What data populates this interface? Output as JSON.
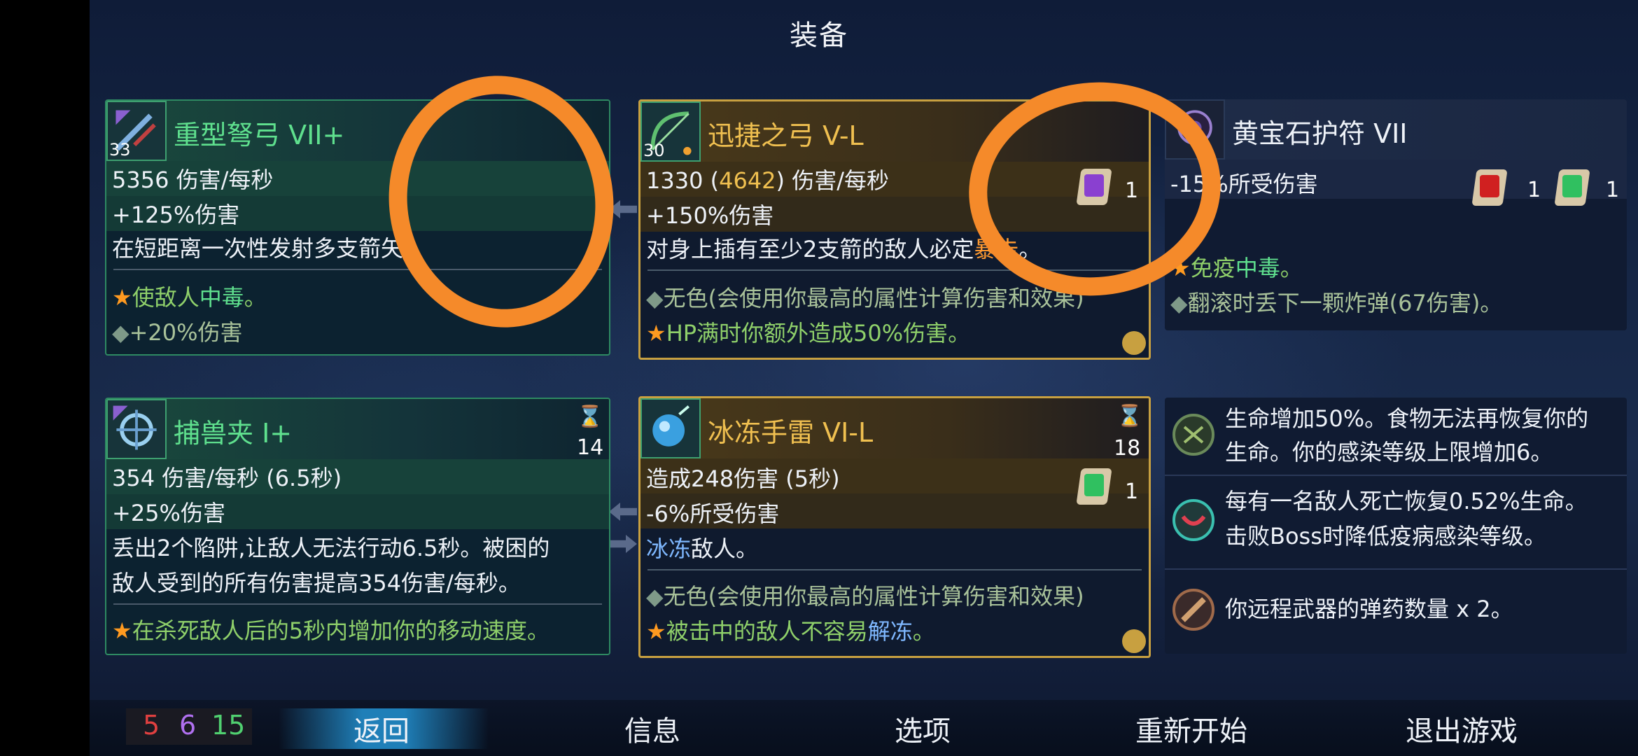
{
  "header": {
    "title": "装备"
  },
  "cards": {
    "crossbow": {
      "level": "33",
      "name": "重型弩弓 VII+",
      "dps_value": "5356",
      "dps_unit": "伤害/每秒",
      "bonus": "+125%伤害",
      "desc": "在短距离一次性发射多支箭矢。",
      "perk1_pre": "使敌人",
      "perk1_hl": "中毒",
      "perk1_post": "。",
      "perk2": "+20%伤害"
    },
    "bow": {
      "level": "30",
      "name": "迅捷之弓 V-L",
      "dps_value": "1330",
      "dps_paren_open": "(",
      "dps_hl": "4642",
      "dps_paren_close": ")",
      "dps_unit": "伤害/每秒",
      "bonus": "+150%伤害",
      "desc_pre": "对身上插有至少2支箭的敌人必定",
      "desc_hl": "暴击",
      "desc_post": "。",
      "scroll_count": "1",
      "perk1": "无色(会使用你最高的属性计算伤害和效果)",
      "perk2": "HP满时你额外造成50%伤害。"
    },
    "amulet": {
      "name": "黄宝石护符 VII",
      "stat": "-15%所受伤害",
      "scroll1_count": "1",
      "scroll2_count": "1",
      "perk1_pre": "免疫",
      "perk1_hl": "中毒",
      "perk1_post": "。",
      "perk2": "翻滚时丢下一颗炸弹(67伤害)。"
    },
    "trap": {
      "name": "捕兽夹 I+",
      "cooldown": "14",
      "dps": "354 伤害/每秒 (6.5秒)",
      "bonus": "+25%伤害",
      "desc1": "丢出2个陷阱,让敌人无法行动6.5秒。被困的",
      "desc2": "敌人受到的所有伤害提高354伤害/每秒。",
      "perk1": "在杀死敌人后的5秒内增加你的移动速度。"
    },
    "grenade": {
      "name": "冰冻手雷 VI-L",
      "cooldown": "18",
      "dmg": "造成248伤害 (5秒)",
      "bonus": "-6%所受伤害",
      "desc_hl": "冰冻",
      "desc_post": "敌人。",
      "scroll_count": "1",
      "perk1": "无色(会使用你最高的属性计算伤害和效果)",
      "perk2_pre": "被击中的敌人不容易",
      "perk2_hl": "解冻",
      "perk2_post": "。"
    }
  },
  "mutations": [
    {
      "line1": "生命增加50%。食物无法再恢复你的",
      "line2": "生命。你的感染等级上限增加6。"
    },
    {
      "line1": "每有一名敌人死亡恢复0.52%生命。",
      "line2": "击败Boss时降低疫病感染等级。"
    },
    {
      "line1": "你远程武器的弹药数量 x 2。",
      "line2": ""
    }
  ],
  "stats": {
    "brutality": "5",
    "tactics": "6",
    "survival": "15"
  },
  "menu": {
    "back": "返回",
    "info": "信息",
    "options": "选项",
    "restart": "重新开始",
    "quit": "退出游戏"
  },
  "colors": {
    "brutality": "#e04040",
    "tactics": "#b070f0",
    "survival": "#50d070",
    "annotation": "#f58a2a"
  }
}
